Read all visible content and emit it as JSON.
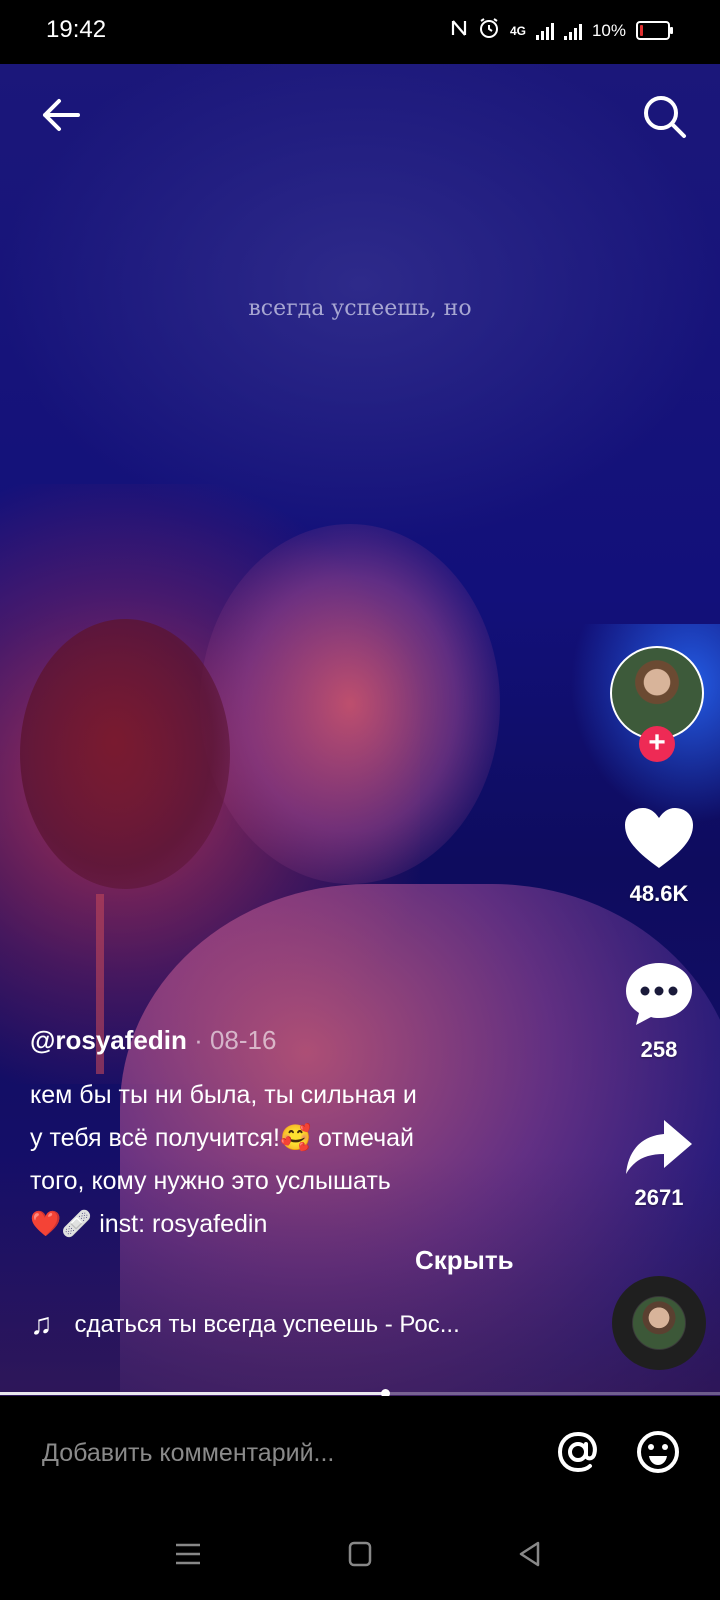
{
  "status_bar": {
    "time": "19:42",
    "network": "4G",
    "battery": "10%",
    "battery_level": 0.1
  },
  "video": {
    "lyric_overlay": "всегда успеешь, но",
    "progress": 0.535
  },
  "top_bar": {
    "back_icon": "arrow-left-icon",
    "search_icon": "search-icon"
  },
  "actions": {
    "follow_symbol": "+",
    "likes": "48.6K",
    "comments": "258",
    "shares": "2671"
  },
  "post": {
    "author": "@rosyafedin",
    "separator": " · ",
    "date": "08-16",
    "caption_lines": [
      "кем бы ты ни была, ты сильная и",
      "у тебя всё получится!🥰  отмечай",
      "того, кому нужно это услышать",
      "❤️🩹 inst: rosyafedin"
    ],
    "hide_label": "Скрыть"
  },
  "music": {
    "note": "♫",
    "title": "сдаться ты всегда успеешь - Рос..."
  },
  "comment_bar": {
    "placeholder": "Добавить комментарий..."
  },
  "colors": {
    "accent": "#ee2a55",
    "background": "#000000"
  }
}
